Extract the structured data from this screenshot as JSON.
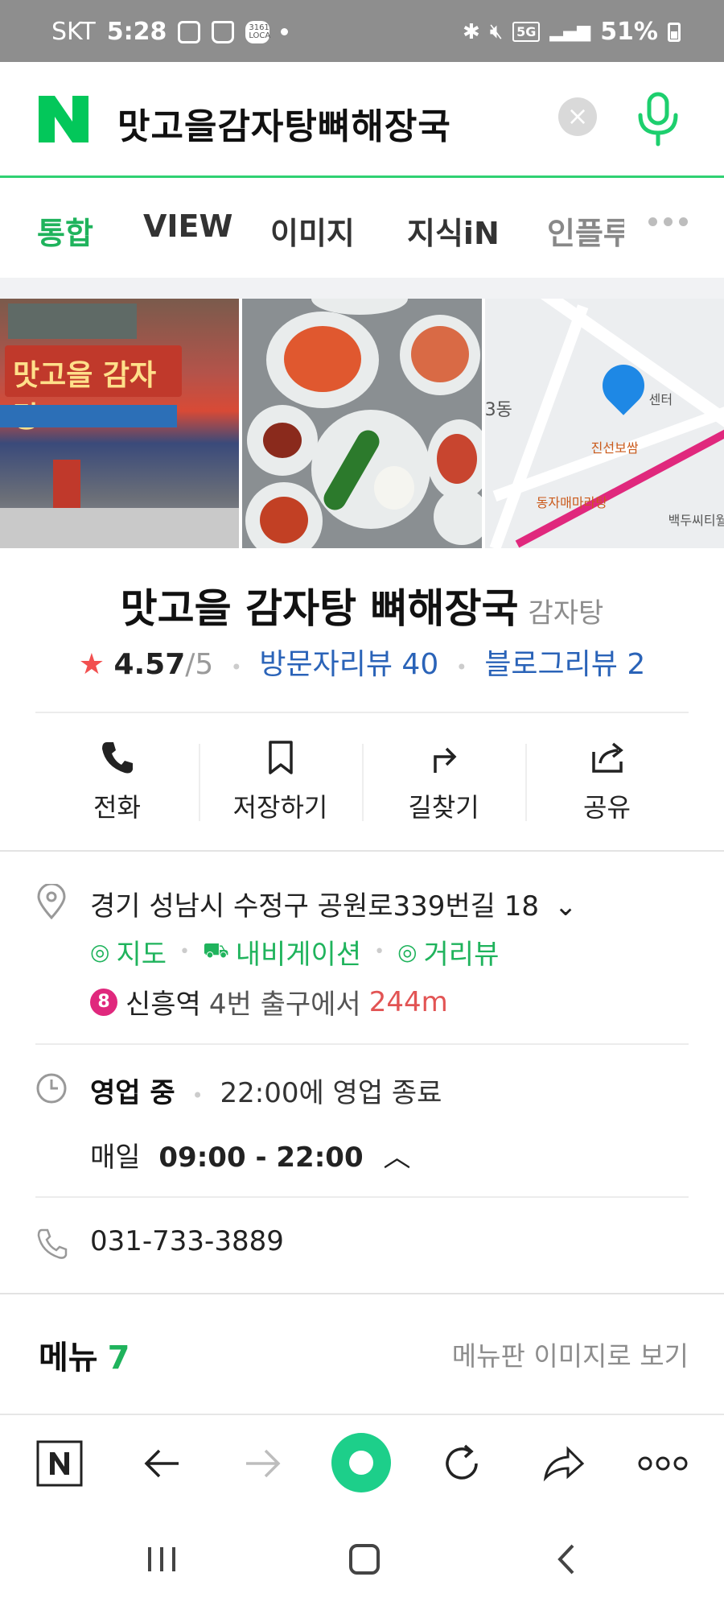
{
  "status_bar": {
    "carrier": "SKT",
    "time": "5:28",
    "badge_text": "3161 LOCA",
    "network": "5G",
    "battery": "51%"
  },
  "search": {
    "query": "맛고을감자탕뼈해장국",
    "clear_symbol": "×"
  },
  "tabs": [
    "통합",
    "VIEW",
    "이미지",
    "지식iN",
    "인플루"
  ],
  "tabs_active_index": 0,
  "place": {
    "name": "맛고을 감자탕 뼈해장국",
    "category": "감자탕",
    "star": "★",
    "rating": "4.57",
    "rating_max": "/5",
    "visitor_reviews": "방문자리뷰 40",
    "blog_reviews": "블로그리뷰 2"
  },
  "photos": {
    "sign_text": "맛고을 감자탕",
    "map_labels": [
      "3동",
      "진선보쌈",
      "동자매마라탕",
      "백두씨티월",
      "센터"
    ]
  },
  "actions": [
    {
      "label": "전화",
      "icon": "phone-icon"
    },
    {
      "label": "저장하기",
      "icon": "bookmark-icon"
    },
    {
      "label": "길찾기",
      "icon": "directions-icon"
    },
    {
      "label": "공유",
      "icon": "share-icon"
    }
  ],
  "info": {
    "address": "경기 성남시 수정구 공원로339번길 18",
    "links": [
      "지도",
      "내비게이션",
      "거리뷰"
    ],
    "subway_line": "8",
    "station_text": "신흥역",
    "station_exit": "4번 출구에서",
    "distance": "244m",
    "open_status": "영업 중",
    "close_info": "22:00에 영업 종료",
    "hours_day": "매일",
    "hours_range": "09:00 - 22:00",
    "phone": "031-733-3889"
  },
  "menu": {
    "title": "메뉴",
    "count": "7",
    "view_link": "메뉴판 이미지로 보기"
  },
  "colors": {
    "naver_green": "#1fb35c",
    "link_blue": "#2a63b8",
    "star_red": "#f25050",
    "distance_red": "#e25454",
    "subway_line8": "#e0287d"
  }
}
